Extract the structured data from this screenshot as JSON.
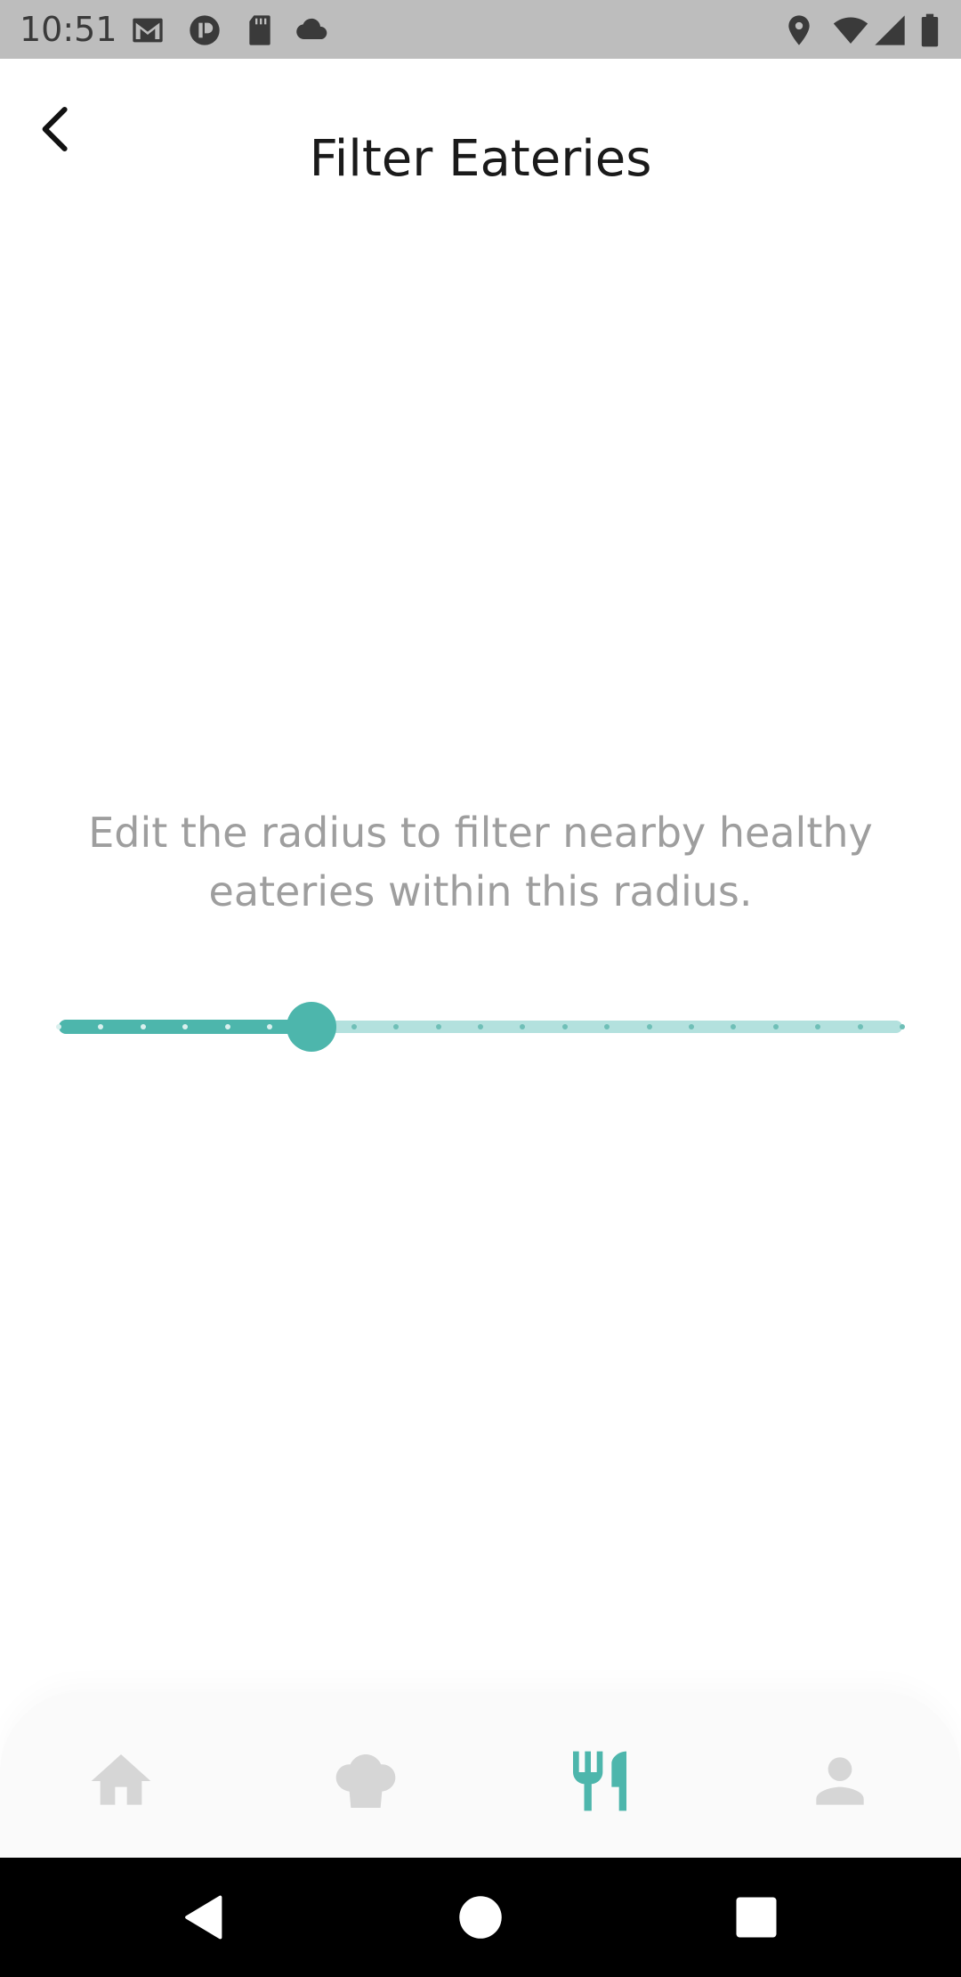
{
  "status_bar": {
    "time": "10:51",
    "left_icons": [
      "gmail-icon",
      "app-icon",
      "sd-card-icon",
      "cloud-icon"
    ],
    "right_icons": [
      "location-icon",
      "wifi-icon",
      "signal-icon",
      "battery-icon"
    ]
  },
  "header": {
    "title": "Filter Eateries",
    "back_icon": "chevron-left-icon"
  },
  "main": {
    "description": "Edit the radius to filter nearby healthy eateries within this radius."
  },
  "slider": {
    "divisions": 20,
    "value_fraction": 0.3,
    "active_color": "#4db6ac",
    "inactive_color": "#b3e1de"
  },
  "bottom_nav": {
    "items": [
      {
        "icon": "home-icon",
        "selected": false
      },
      {
        "icon": "chef-hat-icon",
        "selected": false
      },
      {
        "icon": "fork-knife-icon",
        "selected": true
      },
      {
        "icon": "person-icon",
        "selected": false
      }
    ],
    "active_color": "#4db6ac",
    "inactive_color": "#d6d6d6"
  },
  "system_nav": {
    "buttons": [
      "back-triangle-icon",
      "home-circle-icon",
      "recents-square-icon"
    ]
  }
}
